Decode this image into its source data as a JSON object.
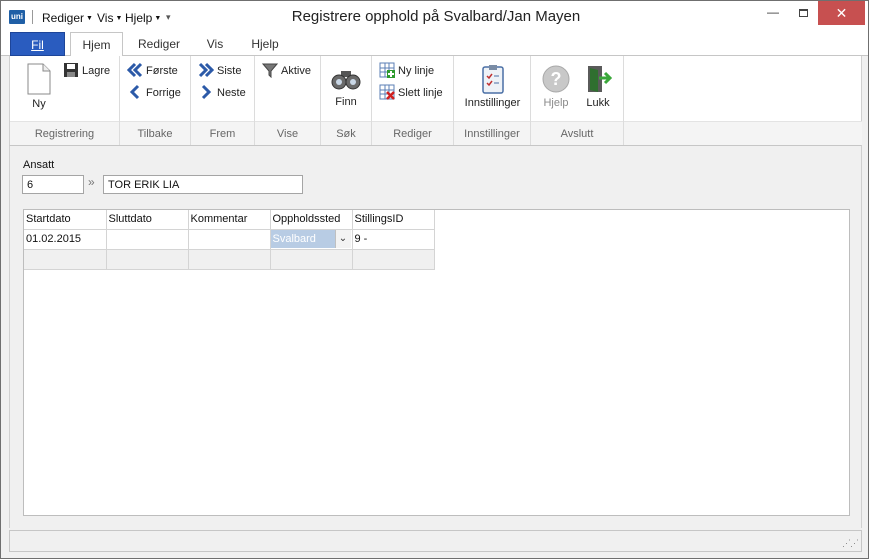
{
  "titlebar": {
    "app_logo_text": "uni",
    "quick_menus": [
      {
        "label": "Rediger"
      },
      {
        "label": "Vis"
      },
      {
        "label": "Hjelp"
      }
    ],
    "window_title": "Registrere opphold på Svalbard/Jan Mayen",
    "close_glyph": "✕",
    "minimize_glyph": "—"
  },
  "ribbon_tabs": {
    "file": "Fil",
    "tabs": [
      "Hjem",
      "Rediger",
      "Vis",
      "Hjelp"
    ],
    "active": "Hjem"
  },
  "ribbon": {
    "registrering": {
      "label": "Registrering",
      "new": "Ny",
      "save": "Lagre"
    },
    "tilbake": {
      "label": "Tilbake",
      "first": "Første",
      "previous": "Forrige"
    },
    "frem": {
      "label": "Frem",
      "last": "Siste",
      "next": "Neste"
    },
    "vise": {
      "label": "Vise",
      "active": "Aktive"
    },
    "sok": {
      "label": "Søk",
      "find": "Finn"
    },
    "rediger": {
      "label": "Rediger",
      "new_line": "Ny linje",
      "delete_line": "Slett linje"
    },
    "innstillinger": {
      "label": "Innstillinger",
      "settings": "Innstillinger"
    },
    "avslutt": {
      "label": "Avslutt",
      "help": "Hjelp",
      "close": "Lukk"
    }
  },
  "icons": {
    "new": "blank-document-icon",
    "save": "floppy-disk-icon",
    "first": "double-chevron-left-icon",
    "previous": "chevron-left-icon",
    "last": "double-chevron-right-icon",
    "next": "chevron-right-icon",
    "active": "funnel-icon",
    "find": "binoculars-icon",
    "new_line": "grid-add-icon",
    "delete_line": "grid-delete-icon",
    "settings": "clipboard-checklist-icon",
    "help": "question-mark-icon",
    "close": "exit-door-icon"
  },
  "form": {
    "employee_label": "Ansatt",
    "employee_id": "6",
    "employee_name": "TOR ERIK LIA"
  },
  "grid": {
    "columns": [
      "Startdato",
      "Sluttdato",
      "Kommentar",
      "Oppholdssted",
      "StillingsID"
    ],
    "rows": [
      {
        "startdato": "01.02.2015",
        "sluttdato": "",
        "kommentar": "",
        "oppholdssted": "Svalbard",
        "stillingsid": "9 -"
      }
    ]
  },
  "colors": {
    "file_tab": "#2a5cbf",
    "close_button": "#c75050",
    "selected_cell": "#b8cce4"
  }
}
